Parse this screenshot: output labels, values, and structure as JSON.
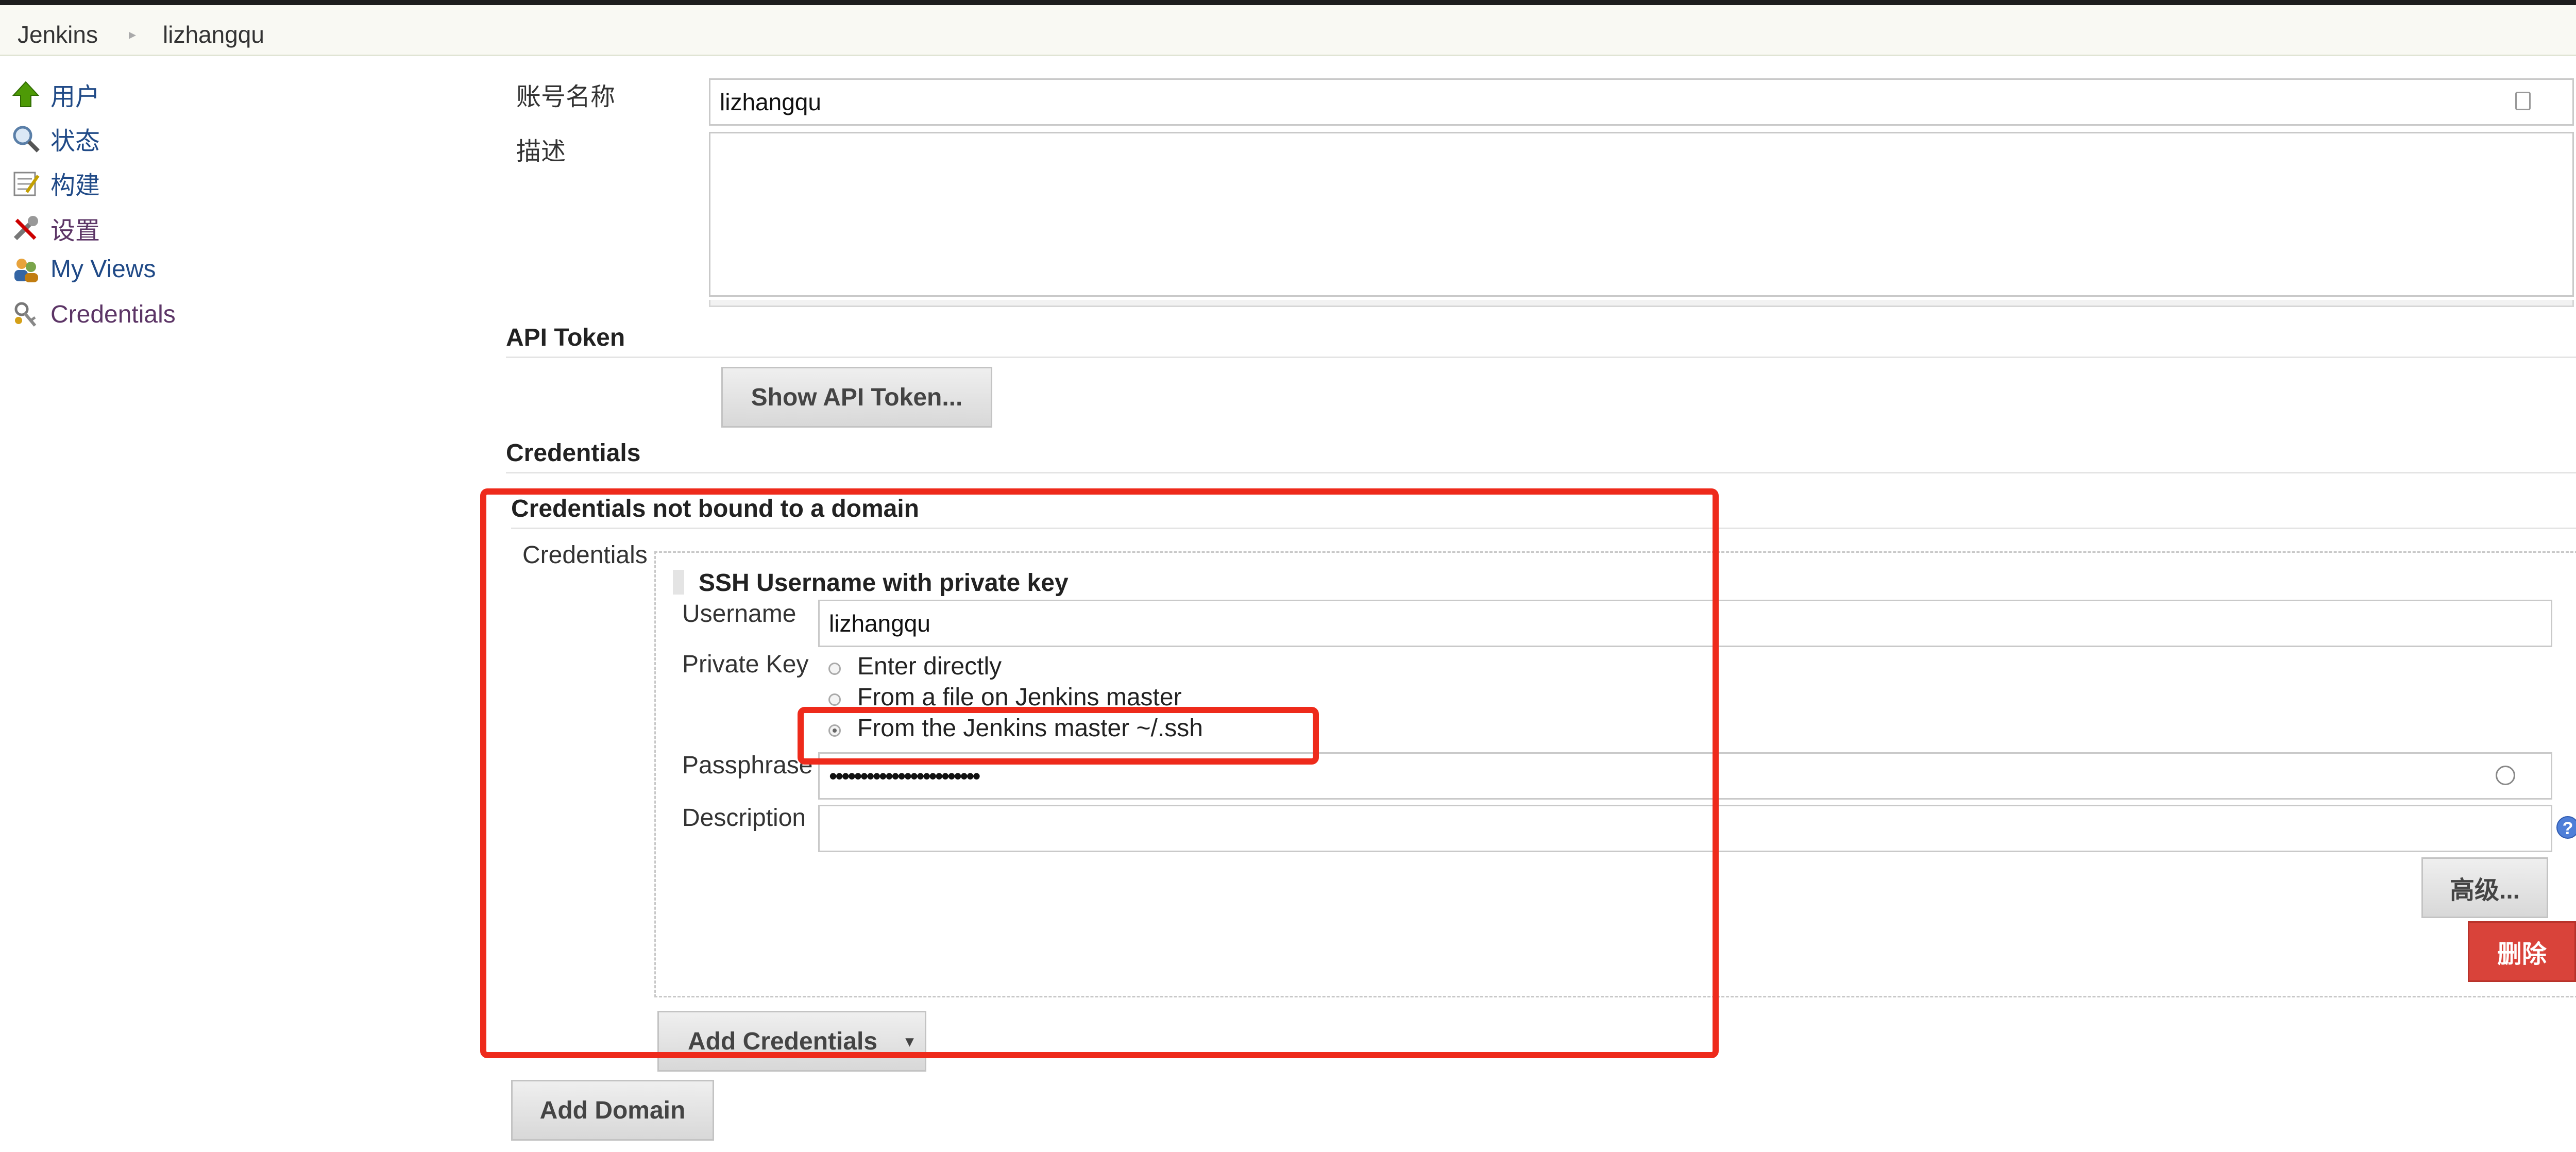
{
  "breadcrumb": {
    "root": "Jenkins",
    "user": "lizhangqu"
  },
  "sidebar": {
    "items": [
      {
        "label": "用户",
        "icon": "up-arrow-icon"
      },
      {
        "label": "状态",
        "icon": "magnifier-icon"
      },
      {
        "label": "构建",
        "icon": "notepad-icon"
      },
      {
        "label": "设置",
        "icon": "wrench-icon"
      },
      {
        "label": "My Views",
        "icon": "users-icon"
      },
      {
        "label": "Credentials",
        "icon": "keys-icon"
      }
    ]
  },
  "account": {
    "name_label": "账号名称",
    "name_value": "lizhangqu",
    "desc_label": "描述",
    "desc_value": ""
  },
  "api_token": {
    "title": "API Token",
    "button": "Show API Token..."
  },
  "credentials": {
    "title": "Credentials",
    "domain_title": "Credentials not bound to a domain",
    "field_label": "Credentials",
    "kind": "SSH Username with private key",
    "username_label": "Username",
    "username_value": "lizhangqu",
    "private_key_label": "Private Key",
    "options": [
      "Enter directly",
      "From a file on Jenkins master",
      "From the Jenkins master ~/.ssh"
    ],
    "selected_option": 2,
    "passphrase_label": "Passphrase",
    "passphrase_value": "••••••••••••••••••••••••",
    "description_label": "Description",
    "description_value": "",
    "advanced_button": "高级...",
    "delete_button": "删除",
    "add_credentials_button": "Add Credentials",
    "add_domain_button": "Add Domain"
  },
  "colors": {
    "link": "#204a87",
    "visited": "#5c3566",
    "danger": "#d9433a",
    "annotation": "#ee2a1b"
  }
}
